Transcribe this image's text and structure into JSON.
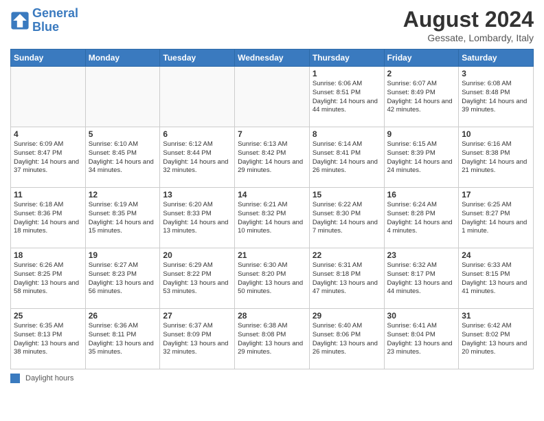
{
  "header": {
    "logo_line1": "General",
    "logo_line2": "Blue",
    "month_year": "August 2024",
    "location": "Gessate, Lombardy, Italy"
  },
  "weekdays": [
    "Sunday",
    "Monday",
    "Tuesday",
    "Wednesday",
    "Thursday",
    "Friday",
    "Saturday"
  ],
  "weeks": [
    [
      {
        "day": "",
        "info": ""
      },
      {
        "day": "",
        "info": ""
      },
      {
        "day": "",
        "info": ""
      },
      {
        "day": "",
        "info": ""
      },
      {
        "day": "1",
        "info": "Sunrise: 6:06 AM\nSunset: 8:51 PM\nDaylight: 14 hours and 44 minutes."
      },
      {
        "day": "2",
        "info": "Sunrise: 6:07 AM\nSunset: 8:49 PM\nDaylight: 14 hours and 42 minutes."
      },
      {
        "day": "3",
        "info": "Sunrise: 6:08 AM\nSunset: 8:48 PM\nDaylight: 14 hours and 39 minutes."
      }
    ],
    [
      {
        "day": "4",
        "info": "Sunrise: 6:09 AM\nSunset: 8:47 PM\nDaylight: 14 hours and 37 minutes."
      },
      {
        "day": "5",
        "info": "Sunrise: 6:10 AM\nSunset: 8:45 PM\nDaylight: 14 hours and 34 minutes."
      },
      {
        "day": "6",
        "info": "Sunrise: 6:12 AM\nSunset: 8:44 PM\nDaylight: 14 hours and 32 minutes."
      },
      {
        "day": "7",
        "info": "Sunrise: 6:13 AM\nSunset: 8:42 PM\nDaylight: 14 hours and 29 minutes."
      },
      {
        "day": "8",
        "info": "Sunrise: 6:14 AM\nSunset: 8:41 PM\nDaylight: 14 hours and 26 minutes."
      },
      {
        "day": "9",
        "info": "Sunrise: 6:15 AM\nSunset: 8:39 PM\nDaylight: 14 hours and 24 minutes."
      },
      {
        "day": "10",
        "info": "Sunrise: 6:16 AM\nSunset: 8:38 PM\nDaylight: 14 hours and 21 minutes."
      }
    ],
    [
      {
        "day": "11",
        "info": "Sunrise: 6:18 AM\nSunset: 8:36 PM\nDaylight: 14 hours and 18 minutes."
      },
      {
        "day": "12",
        "info": "Sunrise: 6:19 AM\nSunset: 8:35 PM\nDaylight: 14 hours and 15 minutes."
      },
      {
        "day": "13",
        "info": "Sunrise: 6:20 AM\nSunset: 8:33 PM\nDaylight: 14 hours and 13 minutes."
      },
      {
        "day": "14",
        "info": "Sunrise: 6:21 AM\nSunset: 8:32 PM\nDaylight: 14 hours and 10 minutes."
      },
      {
        "day": "15",
        "info": "Sunrise: 6:22 AM\nSunset: 8:30 PM\nDaylight: 14 hours and 7 minutes."
      },
      {
        "day": "16",
        "info": "Sunrise: 6:24 AM\nSunset: 8:28 PM\nDaylight: 14 hours and 4 minutes."
      },
      {
        "day": "17",
        "info": "Sunrise: 6:25 AM\nSunset: 8:27 PM\nDaylight: 14 hours and 1 minute."
      }
    ],
    [
      {
        "day": "18",
        "info": "Sunrise: 6:26 AM\nSunset: 8:25 PM\nDaylight: 13 hours and 58 minutes."
      },
      {
        "day": "19",
        "info": "Sunrise: 6:27 AM\nSunset: 8:23 PM\nDaylight: 13 hours and 56 minutes."
      },
      {
        "day": "20",
        "info": "Sunrise: 6:29 AM\nSunset: 8:22 PM\nDaylight: 13 hours and 53 minutes."
      },
      {
        "day": "21",
        "info": "Sunrise: 6:30 AM\nSunset: 8:20 PM\nDaylight: 13 hours and 50 minutes."
      },
      {
        "day": "22",
        "info": "Sunrise: 6:31 AM\nSunset: 8:18 PM\nDaylight: 13 hours and 47 minutes."
      },
      {
        "day": "23",
        "info": "Sunrise: 6:32 AM\nSunset: 8:17 PM\nDaylight: 13 hours and 44 minutes."
      },
      {
        "day": "24",
        "info": "Sunrise: 6:33 AM\nSunset: 8:15 PM\nDaylight: 13 hours and 41 minutes."
      }
    ],
    [
      {
        "day": "25",
        "info": "Sunrise: 6:35 AM\nSunset: 8:13 PM\nDaylight: 13 hours and 38 minutes."
      },
      {
        "day": "26",
        "info": "Sunrise: 6:36 AM\nSunset: 8:11 PM\nDaylight: 13 hours and 35 minutes."
      },
      {
        "day": "27",
        "info": "Sunrise: 6:37 AM\nSunset: 8:09 PM\nDaylight: 13 hours and 32 minutes."
      },
      {
        "day": "28",
        "info": "Sunrise: 6:38 AM\nSunset: 8:08 PM\nDaylight: 13 hours and 29 minutes."
      },
      {
        "day": "29",
        "info": "Sunrise: 6:40 AM\nSunset: 8:06 PM\nDaylight: 13 hours and 26 minutes."
      },
      {
        "day": "30",
        "info": "Sunrise: 6:41 AM\nSunset: 8:04 PM\nDaylight: 13 hours and 23 minutes."
      },
      {
        "day": "31",
        "info": "Sunrise: 6:42 AM\nSunset: 8:02 PM\nDaylight: 13 hours and 20 minutes."
      }
    ]
  ],
  "legend": {
    "daylight_label": "Daylight hours"
  }
}
